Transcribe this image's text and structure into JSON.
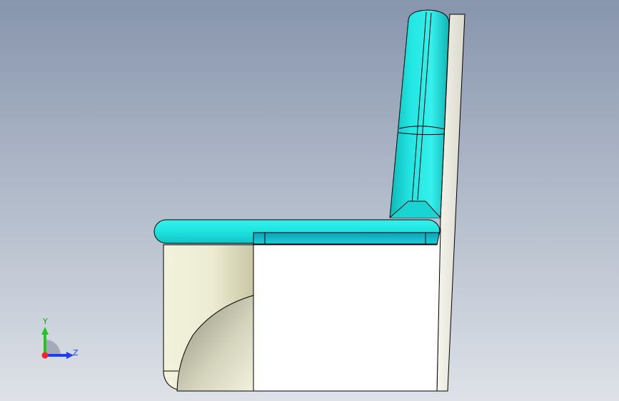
{
  "view": {
    "background_top": "#8795ad",
    "background_bottom": "#dee2e8"
  },
  "model": {
    "cushion_color": "#1ee3e0",
    "cushion_shade": "#0fb3b4",
    "body_color": "#ffffff",
    "armrest_color": "#ecebd2",
    "outline_color": "#000000"
  },
  "triad": {
    "y_label": "Y",
    "z_label": "Z",
    "x_color": "#ff2222",
    "y_color": "#22c822",
    "z_color": "#1e3cff"
  }
}
